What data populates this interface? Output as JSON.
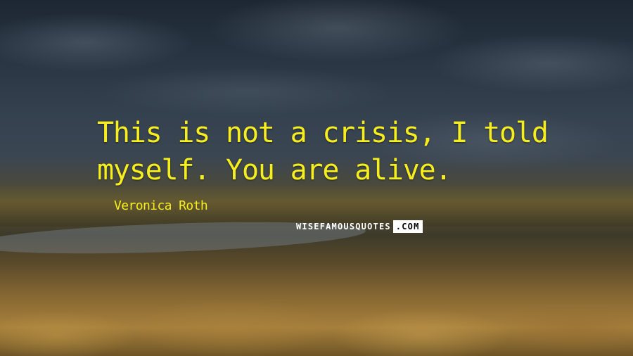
{
  "quote": {
    "text": "This is not a crisis, I told myself. You are alive.",
    "author": "Veronica Roth"
  },
  "watermark": {
    "left": "WISEFAMOUSQUOTES",
    "right": ".COM"
  },
  "colors": {
    "quote_text": "#f7ee1d",
    "watermark_text": "#ffffff",
    "watermark_box": "#ffffff"
  }
}
